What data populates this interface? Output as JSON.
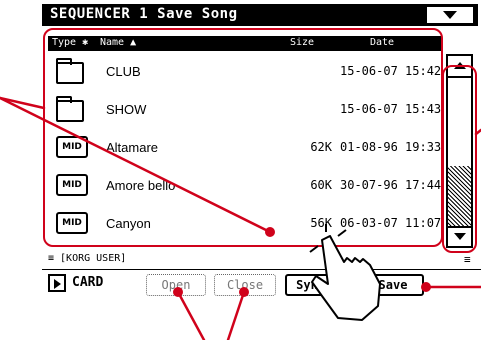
{
  "window": {
    "title": "SEQUENCER 1  Save Song"
  },
  "columns": {
    "type": "Type ✱",
    "name": "Name ▲",
    "size": "Size",
    "date": "Date"
  },
  "files": [
    {
      "icon": "folder-icon",
      "name": "CLUB",
      "size": "",
      "date": "15-06-07 15:42"
    },
    {
      "icon": "folder-icon",
      "name": "SHOW",
      "size": "",
      "date": "15-06-07 15:43"
    },
    {
      "icon": "midi-file-icon",
      "name": "Altamare",
      "size": "62K",
      "date": "01-08-96 19:33"
    },
    {
      "icon": "midi-file-icon",
      "name": "Amore bello",
      "size": "60K",
      "date": "30-07-96 17:44"
    },
    {
      "icon": "midi-file-icon",
      "name": "Canyon",
      "size": "56K",
      "date": "06-03-07 11:07"
    }
  ],
  "midi_icon_label": "MID",
  "path": "≡ [KORG USER]",
  "device": {
    "label": "CARD"
  },
  "buttons": {
    "open": "Open",
    "close": "Close",
    "sync": "Syn",
    "save": "Save"
  },
  "colors": {
    "annotation": "#d0021b",
    "foreground": "#000000",
    "background": "#ffffff"
  }
}
